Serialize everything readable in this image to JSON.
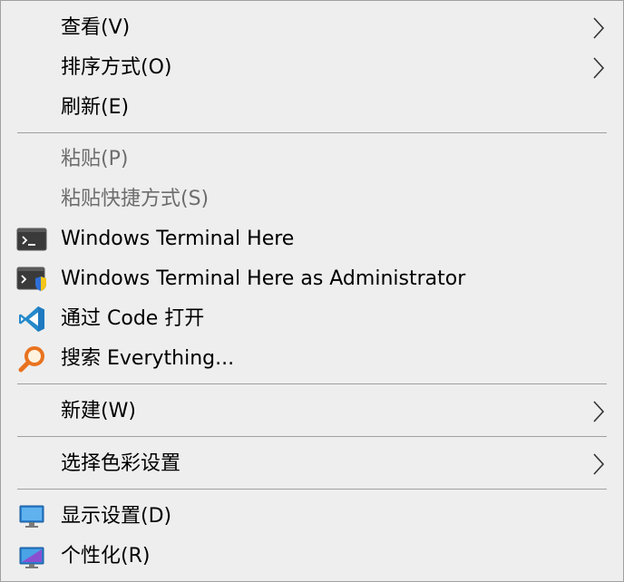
{
  "menu": {
    "items": [
      {
        "label": "查看(V)",
        "submenu": true,
        "enabled": true
      },
      {
        "label": "排序方式(O)",
        "submenu": true,
        "enabled": true
      },
      {
        "label": "刷新(E)",
        "submenu": false,
        "enabled": true
      },
      {
        "label": "粘贴(P)",
        "submenu": false,
        "enabled": false
      },
      {
        "label": "粘贴快捷方式(S)",
        "submenu": false,
        "enabled": false
      },
      {
        "label": "Windows Terminal Here",
        "icon": "terminal-icon",
        "enabled": true
      },
      {
        "label": "Windows Terminal Here as Administrator",
        "icon": "terminal-admin-icon",
        "enabled": true
      },
      {
        "label": "通过 Code 打开",
        "icon": "vscode-icon",
        "enabled": true
      },
      {
        "label": "搜索 Everything...",
        "icon": "everything-search-icon",
        "enabled": true
      },
      {
        "label": "新建(W)",
        "submenu": true,
        "enabled": true
      },
      {
        "label": "选择色彩设置",
        "submenu": true,
        "enabled": true
      },
      {
        "label": "显示设置(D)",
        "icon": "display-settings-icon",
        "enabled": true
      },
      {
        "label": "个性化(R)",
        "icon": "personalize-icon",
        "enabled": true
      }
    ]
  },
  "colors": {
    "background": "#eeeeee",
    "border": "#a0a0a0",
    "text": "#000000",
    "disabled_text": "#6d6d6d",
    "vscode_blue": "#2489ca",
    "everything_orange": "#e8731f"
  }
}
